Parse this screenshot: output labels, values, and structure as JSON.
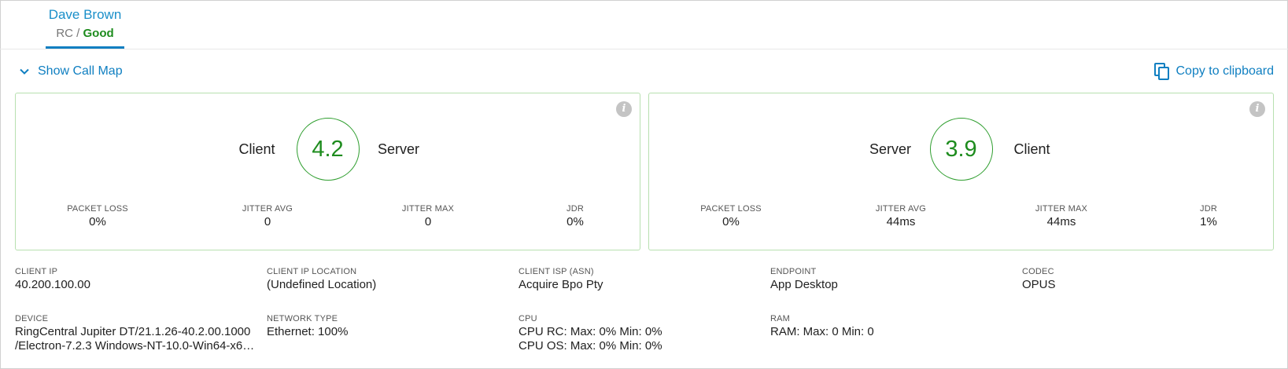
{
  "header": {
    "name": "Dave Brown",
    "source": "RC",
    "separator": " / ",
    "quality": "Good"
  },
  "actions": {
    "show_call_map": "Show Call Map",
    "copy_to_clipboard": "Copy to clipboard"
  },
  "cards": [
    {
      "left_label": "Client",
      "score": "4.2",
      "right_label": "Server",
      "metrics": [
        {
          "label": "PACKET LOSS",
          "value": "0%"
        },
        {
          "label": "JITTER AVG",
          "value": "0"
        },
        {
          "label": "JITTER MAX",
          "value": "0"
        },
        {
          "label": "JDR",
          "value": "0%"
        }
      ]
    },
    {
      "left_label": "Server",
      "score": "3.9",
      "right_label": "Client",
      "metrics": [
        {
          "label": "PACKET LOSS",
          "value": "0%"
        },
        {
          "label": "JITTER AVG",
          "value": "44ms"
        },
        {
          "label": "JITTER MAX",
          "value": "44ms"
        },
        {
          "label": "JDR",
          "value": "1%"
        }
      ]
    }
  ],
  "details": {
    "client_ip": {
      "label": "CLIENT IP",
      "value": "40.200.100.00"
    },
    "client_ip_location": {
      "label": "CLIENT IP LOCATION",
      "value": "(Undefined Location)"
    },
    "client_isp": {
      "label": "CLIENT ISP (ASN)",
      "value": "Acquire Bpo Pty"
    },
    "endpoint": {
      "label": "ENDPOINT",
      "value": "App Desktop"
    },
    "codec": {
      "label": "CODEC",
      "value": "OPUS"
    },
    "device": {
      "label": "DEVICE",
      "line1": "RingCentral Jupiter DT/21.1.26-40.2.00.1000",
      "line2": "/Electron-7.2.3 Windows-NT-10.0-Win64-x64..."
    },
    "network_type": {
      "label": "NETWORK TYPE",
      "value": "Ethernet: 100%"
    },
    "cpu": {
      "label": "CPU",
      "line1": "CPU RC: Max: 0% Min: 0%",
      "line2": "CPU OS: Max: 0% Min: 0%"
    },
    "ram": {
      "label": "RAM",
      "value": "RAM: Max: 0 Min: 0"
    }
  },
  "icons": {
    "chevron": "chevron-down-icon",
    "copy": "copy-icon",
    "info": "info-icon"
  },
  "colors": {
    "accent": "#0f7fc1",
    "good": "#1e8c1e",
    "card_border": "#b8e0b0"
  }
}
